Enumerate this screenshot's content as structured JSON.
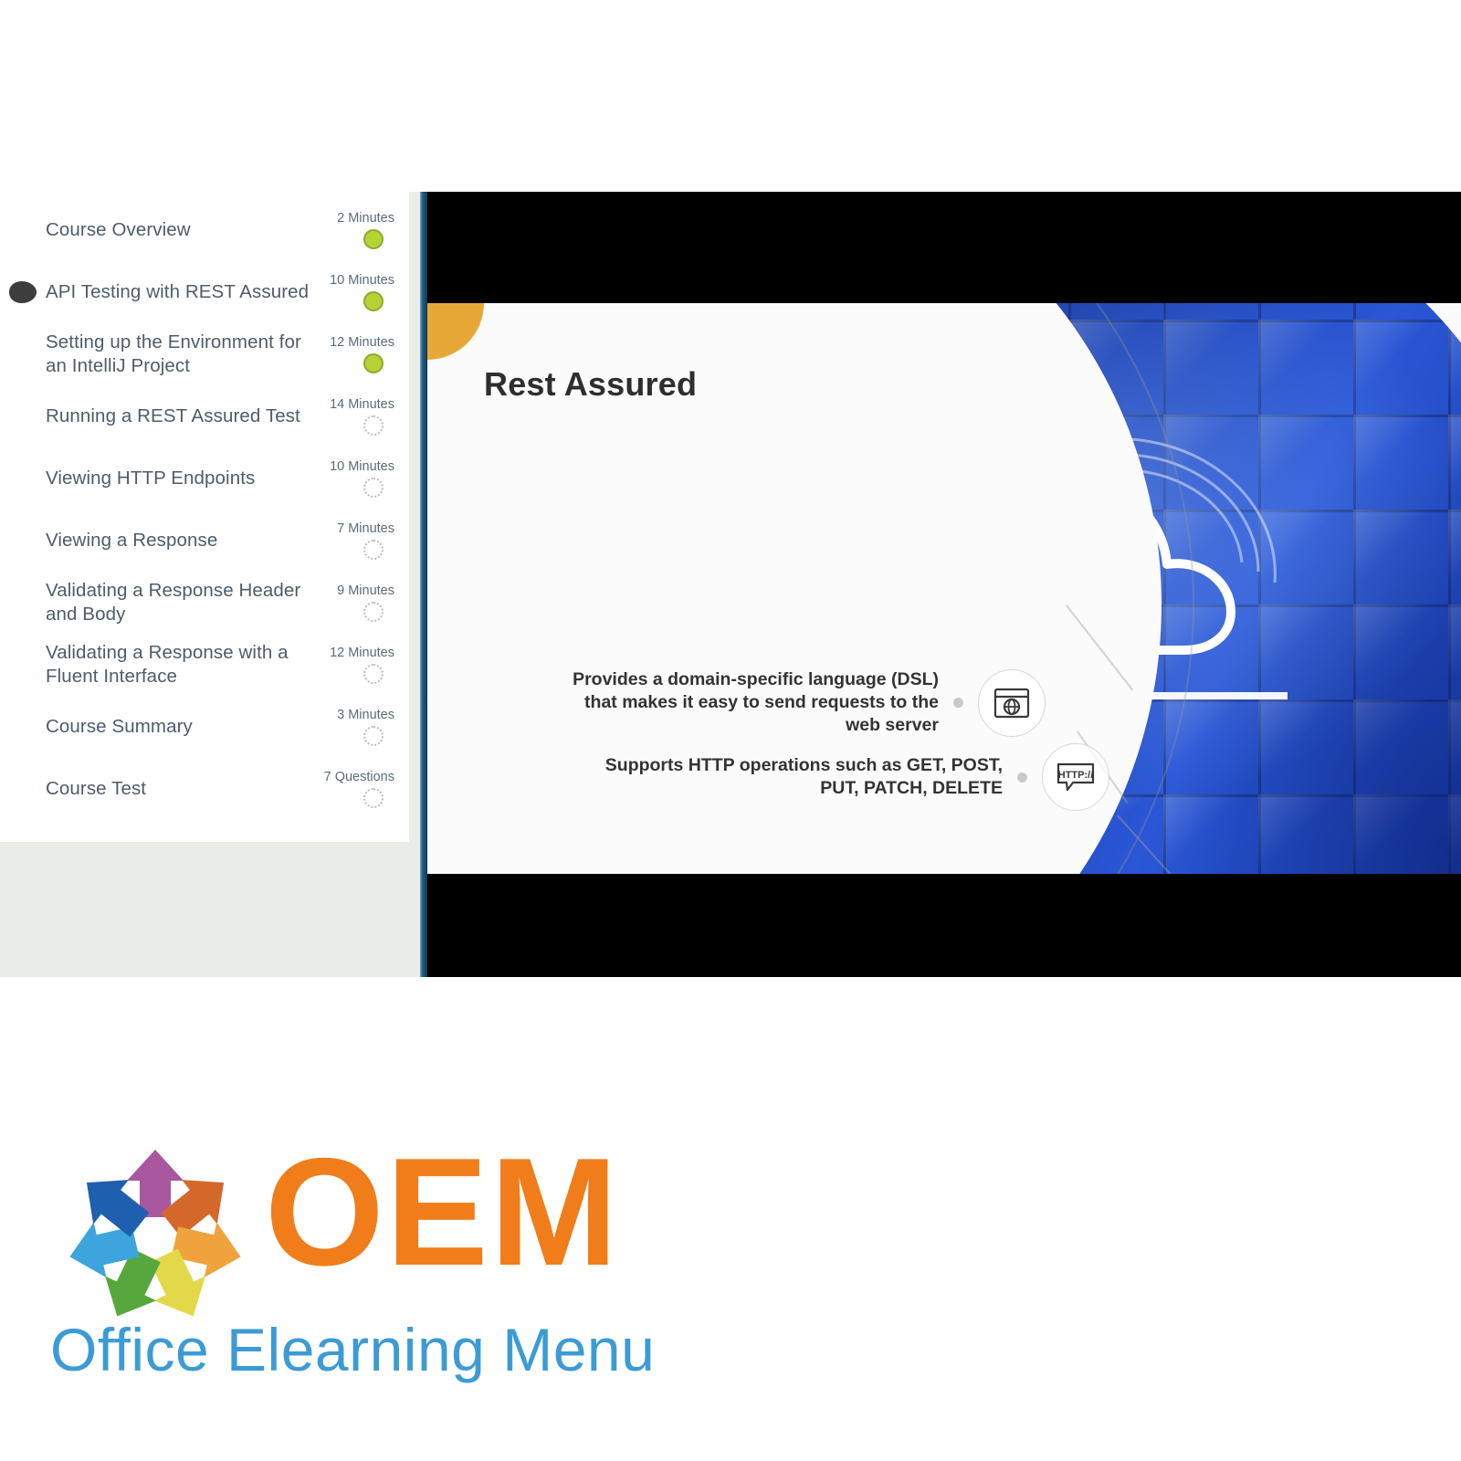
{
  "player": {
    "sidebar": {
      "items": [
        {
          "title": "Course Overview",
          "meta": "2 Minutes",
          "status": "complete",
          "active": false
        },
        {
          "title": "API Testing with REST Assured",
          "meta": "10 Minutes",
          "status": "complete",
          "active": true
        },
        {
          "title": "Setting up the Environment for an IntelliJ Project",
          "meta": "12 Minutes",
          "status": "complete",
          "active": false
        },
        {
          "title": "Running a REST Assured Test",
          "meta": "14 Minutes",
          "status": "incomplete",
          "active": false
        },
        {
          "title": "Viewing HTTP Endpoints",
          "meta": "10 Minutes",
          "status": "incomplete",
          "active": false
        },
        {
          "title": "Viewing a Response",
          "meta": "7 Minutes",
          "status": "incomplete",
          "active": false
        },
        {
          "title": "Validating a Response Header and Body",
          "meta": "9 Minutes",
          "status": "incomplete",
          "active": false
        },
        {
          "title": "Validating a Response with a Fluent Interface",
          "meta": "12 Minutes",
          "status": "incomplete",
          "active": false
        },
        {
          "title": "Course Summary",
          "meta": "3 Minutes",
          "status": "incomplete",
          "active": false
        },
        {
          "title": "Course Test",
          "meta": "7 Questions",
          "status": "incomplete",
          "active": false
        }
      ]
    },
    "slide": {
      "title": "Rest Assured",
      "bullets": [
        {
          "text": "Provides a domain-specific language (DSL) that makes it easy to send requests to the web server",
          "icon": "browser-globe-icon"
        },
        {
          "text": "Supports HTTP operations such as GET, POST, PUT, PATCH, DELETE",
          "icon": "http-bubble-icon"
        }
      ],
      "image_alt": "cloud-padlock-security-icon"
    }
  },
  "logo": {
    "wordmark": "OEM",
    "tagline": "Office Elearning Menu",
    "arrows": [
      {
        "name": "arrow-up",
        "color": "#a9579e"
      },
      {
        "name": "arrow-right",
        "color": "#d4682a"
      },
      {
        "name": "arrow-down-right",
        "color": "#f0a23c"
      },
      {
        "name": "arrow-down",
        "color": "#e3d84a"
      },
      {
        "name": "arrow-down-left",
        "color": "#56a83c"
      },
      {
        "name": "arrow-left",
        "color": "#3ea4dd"
      },
      {
        "name": "arrow-up-left",
        "color": "#1e5fb0"
      }
    ]
  },
  "colors": {
    "accent_orange": "#f07d1a",
    "accent_blue": "#3c9bd6",
    "status_complete": "#b5d334",
    "status_incomplete": "#b9bcbe",
    "divider_blue": "#1d5c86",
    "slide_dot_orange": "#e8a838"
  }
}
